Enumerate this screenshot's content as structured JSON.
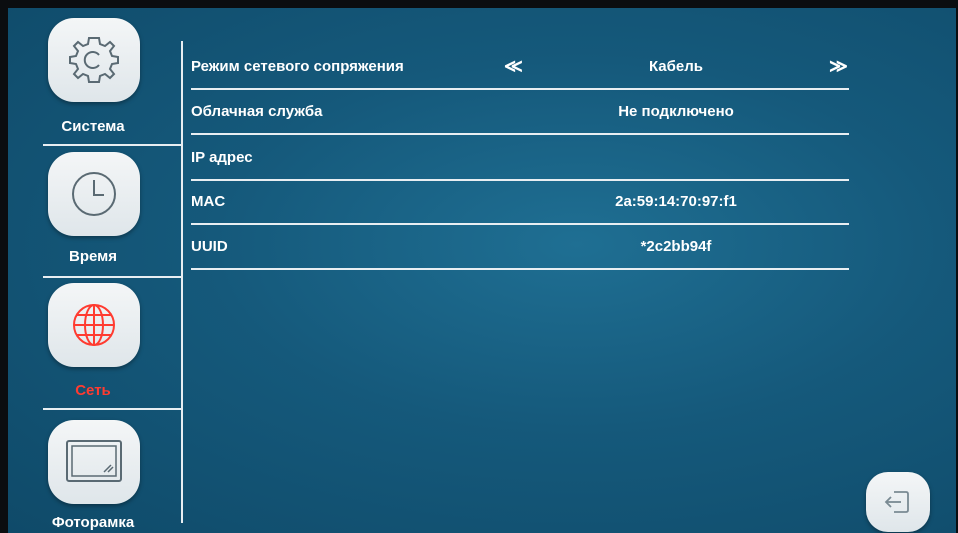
{
  "sidebar": {
    "items": [
      {
        "label": "Система",
        "icon": "gear-icon",
        "active": false
      },
      {
        "label": "Время",
        "icon": "clock-icon",
        "active": false
      },
      {
        "label": "Сеть",
        "icon": "globe-icon",
        "active": true
      },
      {
        "label": "Фоторамка",
        "icon": "photo-frame-icon",
        "active": false
      }
    ]
  },
  "network": {
    "mode": {
      "label": "Режим сетевого сопряжения",
      "value": "Кабель",
      "prev": "≪",
      "next": "≫"
    },
    "cloud": {
      "label": "Облачная служба",
      "value": "Не подключено"
    },
    "ip": {
      "label": "IP адрес",
      "value": ""
    },
    "mac": {
      "label": "MAC",
      "value": "2a:59:14:70:97:f1"
    },
    "uuid": {
      "label": "UUID",
      "value": "*2c2bb94f"
    }
  },
  "colors": {
    "active": "#ff3b30",
    "background": "#15597b",
    "text": "#ffffff"
  }
}
